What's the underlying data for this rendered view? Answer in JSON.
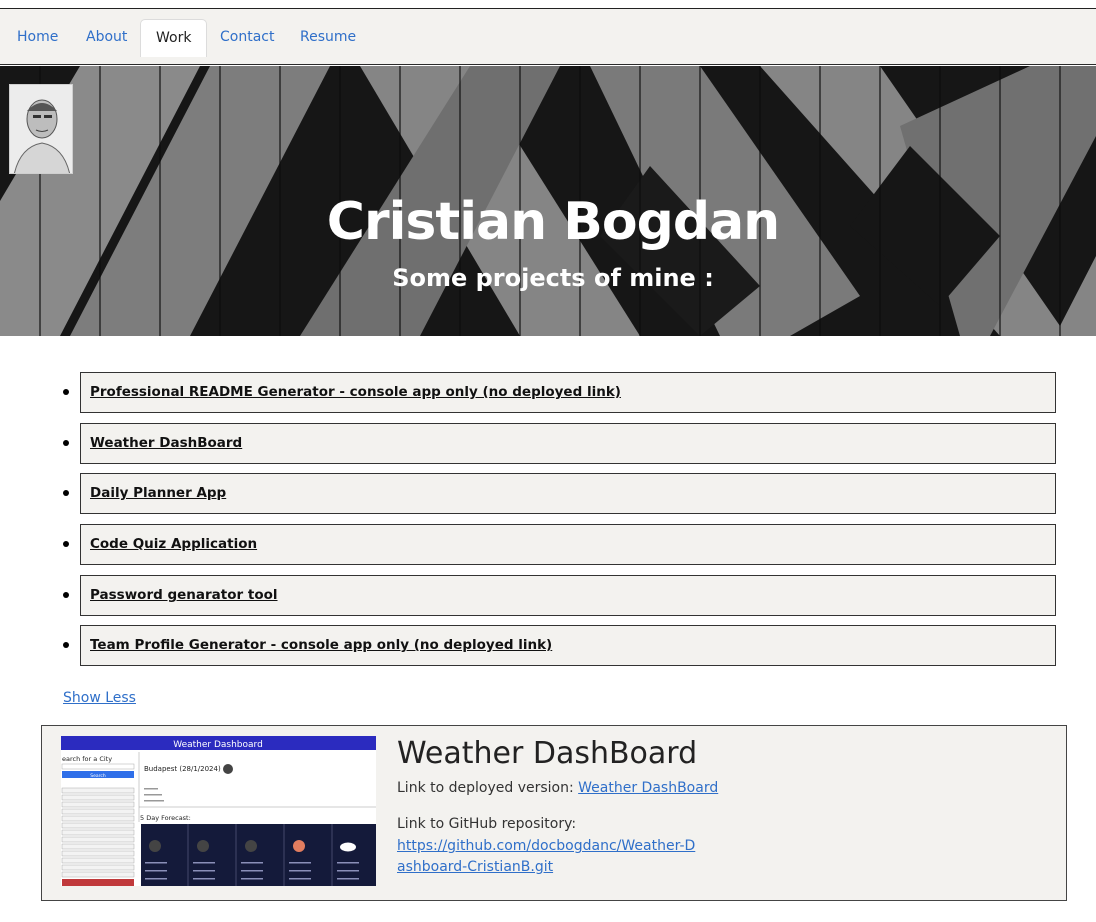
{
  "nav": {
    "items": [
      {
        "label": "Home"
      },
      {
        "label": "About"
      },
      {
        "label": "Work"
      },
      {
        "label": "Contact"
      },
      {
        "label": "Resume"
      }
    ]
  },
  "hero": {
    "title": "Cristian Bogdan",
    "subtitle": "Some projects of mine :"
  },
  "projects": [
    {
      "label": "Professional README Generator - console app only (no deployed link)"
    },
    {
      "label": "Weather DashBoard"
    },
    {
      "label": "Daily Planner App"
    },
    {
      "label": "Code Quiz Application"
    },
    {
      "label": "Password genarator tool"
    },
    {
      "label": "Team Profile Generator - console app only (no deployed link)"
    }
  ],
  "show_less": "Show Less",
  "card": {
    "title": "Weather DashBoard",
    "deployed_prefix": "Link to deployed version: ",
    "deployed_link": "Weather DashBoard",
    "github_prefix": "Link to GitHub repository:",
    "github_link": "https://github.com/docbogdanc/Weather-Dashboard-CristianB.git",
    "thumbnail": {
      "header": "Weather Dashboard",
      "search_label": "earch for a City",
      "search_button": "Search",
      "city_line": "Budapest (28/1/2024)",
      "forecast_label": "5 Day Forecast:"
    }
  },
  "colors": {
    "link": "#2f6fc9",
    "nav_bg": "#f3f2ef",
    "card_bg": "#f3f2ef",
    "thumb_header": "#2b2bbf",
    "forecast_bg": "#141a3a",
    "history_button": "#c0393b"
  }
}
